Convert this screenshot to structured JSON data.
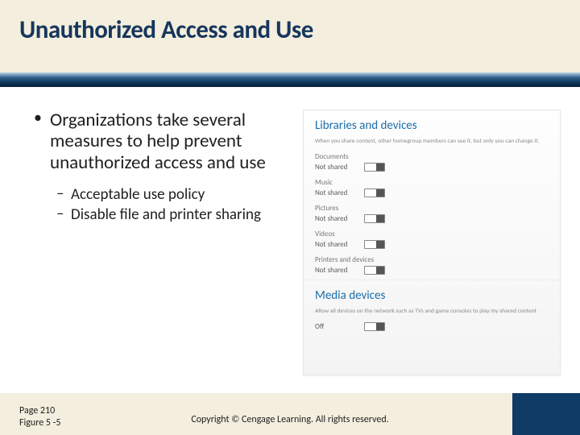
{
  "title": "Unauthorized Access and Use",
  "bullets": {
    "main": "Organizations take several measures to help prevent unauthorized access and use",
    "sub": [
      "Acceptable use policy",
      "Disable file and printer sharing"
    ]
  },
  "screenshot": {
    "section1": {
      "title": "Libraries and devices",
      "desc": "When you share content, other homegroup members can see it, but only you can change it.",
      "items": [
        {
          "label": "Documents",
          "status": "Not shared"
        },
        {
          "label": "Music",
          "status": "Not shared"
        },
        {
          "label": "Pictures",
          "status": "Not shared"
        },
        {
          "label": "Videos",
          "status": "Not shared"
        },
        {
          "label": "Printers and devices",
          "status": "Not shared"
        }
      ]
    },
    "section2": {
      "title": "Media devices",
      "desc": "Allow all devices on the network such as TVs and game consoles to play my shared content",
      "status": "Off"
    }
  },
  "footer": {
    "page": "Page 210",
    "figure": "Figure 5 -5",
    "copyright": "Copyright © Cengage Learning. All rights reserved."
  }
}
